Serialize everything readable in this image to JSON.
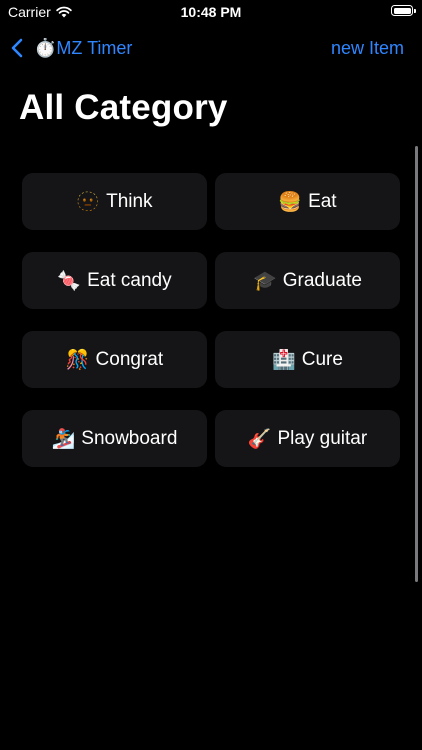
{
  "status_bar": {
    "carrier": "Carrier",
    "time": "10:48 PM",
    "wifi_icon": "wifi-icon",
    "battery_icon": "battery-icon"
  },
  "nav": {
    "back_label": "⏱️MZ Timer",
    "action_label": "new Item",
    "accent_color": "#2f86ff"
  },
  "title": "All Category",
  "categories": [
    {
      "emoji": "🫥",
      "label": "Think"
    },
    {
      "emoji": "🍔",
      "label": "Eat"
    },
    {
      "emoji": "🍬",
      "label": "Eat candy"
    },
    {
      "emoji": "🎓",
      "label": "Graduate"
    },
    {
      "emoji": "🎊",
      "label": "Congrat"
    },
    {
      "emoji": "🏥",
      "label": "Cure"
    },
    {
      "emoji": "🏂",
      "label": "Snowboard"
    },
    {
      "emoji": "🎸",
      "label": "Play guitar"
    }
  ]
}
